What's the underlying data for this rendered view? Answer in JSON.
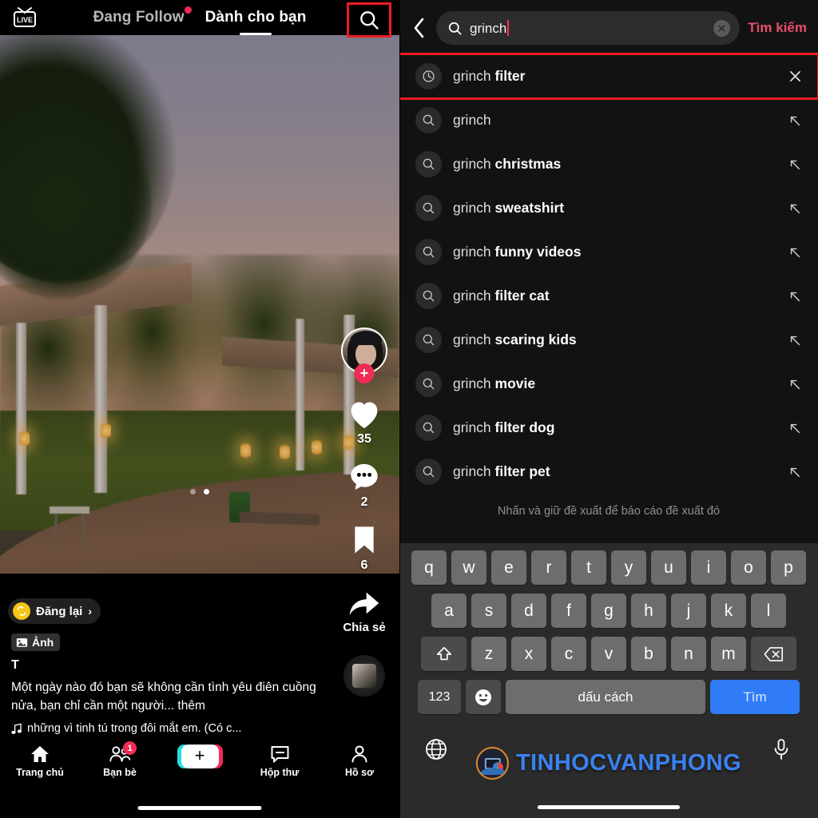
{
  "left_panel": {
    "top_bar": {
      "live_label": "LIVE",
      "tabs": [
        {
          "label": "Đang Follow",
          "active": false,
          "has_dot": true
        },
        {
          "label": "Dành cho bạn",
          "active": true,
          "has_dot": false
        }
      ],
      "search_icon": "search-icon",
      "highlight_color": "#ee1c24"
    },
    "rail": {
      "follow_plus": "+",
      "like_count": "35",
      "comment_count": "2",
      "bookmark_count": "6",
      "share_label": "Chia sẻ"
    },
    "carousel": {
      "dots": 2,
      "active_index": 1
    },
    "caption": {
      "repost_label": "Đăng lại",
      "repost_chevron": "›",
      "photo_tag": "Ảnh",
      "text_marker": "T",
      "description": "Một ngày nào đó bạn sẽ không cần tình yêu điên cuồng nửa, bạn chỉ cần một người... thêm",
      "music": "những vì tinh tú trong đôi mắt em. (Có c..."
    },
    "bottom_nav": [
      {
        "label": "Trang chủ",
        "icon": "home-icon",
        "badge": null
      },
      {
        "label": "Bạn bè",
        "icon": "friends-icon",
        "badge": "1"
      },
      {
        "label": "",
        "icon": "create-icon",
        "badge": null
      },
      {
        "label": "Hộp thư",
        "icon": "inbox-icon",
        "badge": null
      },
      {
        "label": "Hồ sơ",
        "icon": "profile-icon",
        "badge": null
      }
    ]
  },
  "right_panel": {
    "header": {
      "back_icon": "back-chevron-icon",
      "search_value": "grinch",
      "search_placeholder": "Tìm kiếm",
      "clear_icon": "clear-circle-icon",
      "action_label": "Tìm kiếm",
      "action_color": "#e8506a"
    },
    "suggestions": [
      {
        "prefix": "grinch ",
        "bold": "filter",
        "icon": "clock-icon",
        "end_icon": "close-icon",
        "highlighted": true
      },
      {
        "prefix": "grinch",
        "bold": "",
        "icon": "search-icon",
        "end_icon": "arrow-up-left-icon",
        "highlighted": false
      },
      {
        "prefix": "grinch ",
        "bold": "christmas",
        "icon": "search-icon",
        "end_icon": "arrow-up-left-icon",
        "highlighted": false
      },
      {
        "prefix": "grinch ",
        "bold": "sweatshirt",
        "icon": "search-icon",
        "end_icon": "arrow-up-left-icon",
        "highlighted": false
      },
      {
        "prefix": "grinch ",
        "bold": "funny videos",
        "icon": "search-icon",
        "end_icon": "arrow-up-left-icon",
        "highlighted": false
      },
      {
        "prefix": "grinch ",
        "bold": "filter cat",
        "icon": "search-icon",
        "end_icon": "arrow-up-left-icon",
        "highlighted": false
      },
      {
        "prefix": "grinch ",
        "bold": "scaring kids",
        "icon": "search-icon",
        "end_icon": "arrow-up-left-icon",
        "highlighted": false
      },
      {
        "prefix": "grinch ",
        "bold": "movie",
        "icon": "search-icon",
        "end_icon": "arrow-up-left-icon",
        "highlighted": false
      },
      {
        "prefix": "grinch ",
        "bold": "filter dog",
        "icon": "search-icon",
        "end_icon": "arrow-up-left-icon",
        "highlighted": false
      },
      {
        "prefix": "grinch ",
        "bold": "filter pet",
        "icon": "search-icon",
        "end_icon": "arrow-up-left-icon",
        "highlighted": false
      }
    ],
    "report_hint": "Nhấn và giữ đề xuất để báo cáo đề xuất đó",
    "keyboard": {
      "row1": [
        "q",
        "w",
        "e",
        "r",
        "t",
        "y",
        "u",
        "i",
        "o",
        "p"
      ],
      "row2": [
        "a",
        "s",
        "d",
        "f",
        "g",
        "h",
        "j",
        "k",
        "l"
      ],
      "row3": [
        "z",
        "x",
        "c",
        "v",
        "b",
        "n",
        "m"
      ],
      "shift_icon": "shift-icon",
      "backspace_icon": "backspace-icon",
      "numbers_key": "123",
      "emoji_icon": "emoji-icon",
      "space_label": "dấu cách",
      "go_label": "Tìm",
      "go_color": "#2f7cf6",
      "globe_icon": "globe-icon",
      "mic_icon": "microphone-icon"
    }
  },
  "watermark": {
    "text": "TINHOCVANPHONG",
    "color": "#3b82f0",
    "logo_ring_color": "#e08a2e"
  }
}
